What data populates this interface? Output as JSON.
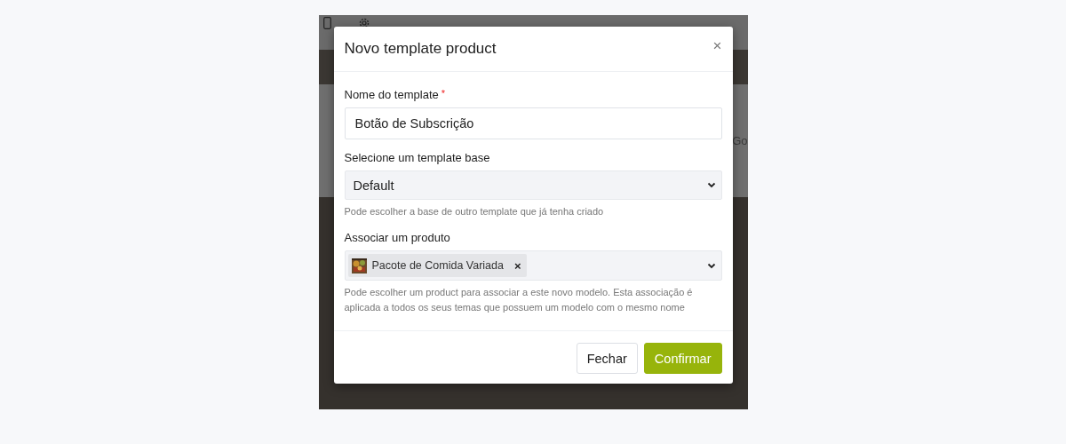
{
  "background": {
    "side_text": "Go"
  },
  "dialog": {
    "title": "Novo template product",
    "close": "×",
    "fields": [
      {
        "kind": "text",
        "label": "Nome do template",
        "required_mark": "*",
        "value": "Botão de Subscrição"
      },
      {
        "kind": "select",
        "label": "Selecione um template base",
        "value": "Default",
        "help": "Pode escolher a base de outro template que já tenha criado"
      },
      {
        "kind": "tags",
        "label": "Associar um produto",
        "tags": [
          {
            "label": "Pacote de Comida Variada",
            "remove": "×"
          }
        ],
        "help": "Pode escolher um product para associar a este novo modelo. Esta associação é aplicada a todos os seus temas que possuem um modelo com o mesmo nome"
      }
    ],
    "buttons": [
      {
        "label": "Fechar",
        "kind": "secondary"
      },
      {
        "label": "Confirmar",
        "kind": "primary"
      }
    ]
  }
}
